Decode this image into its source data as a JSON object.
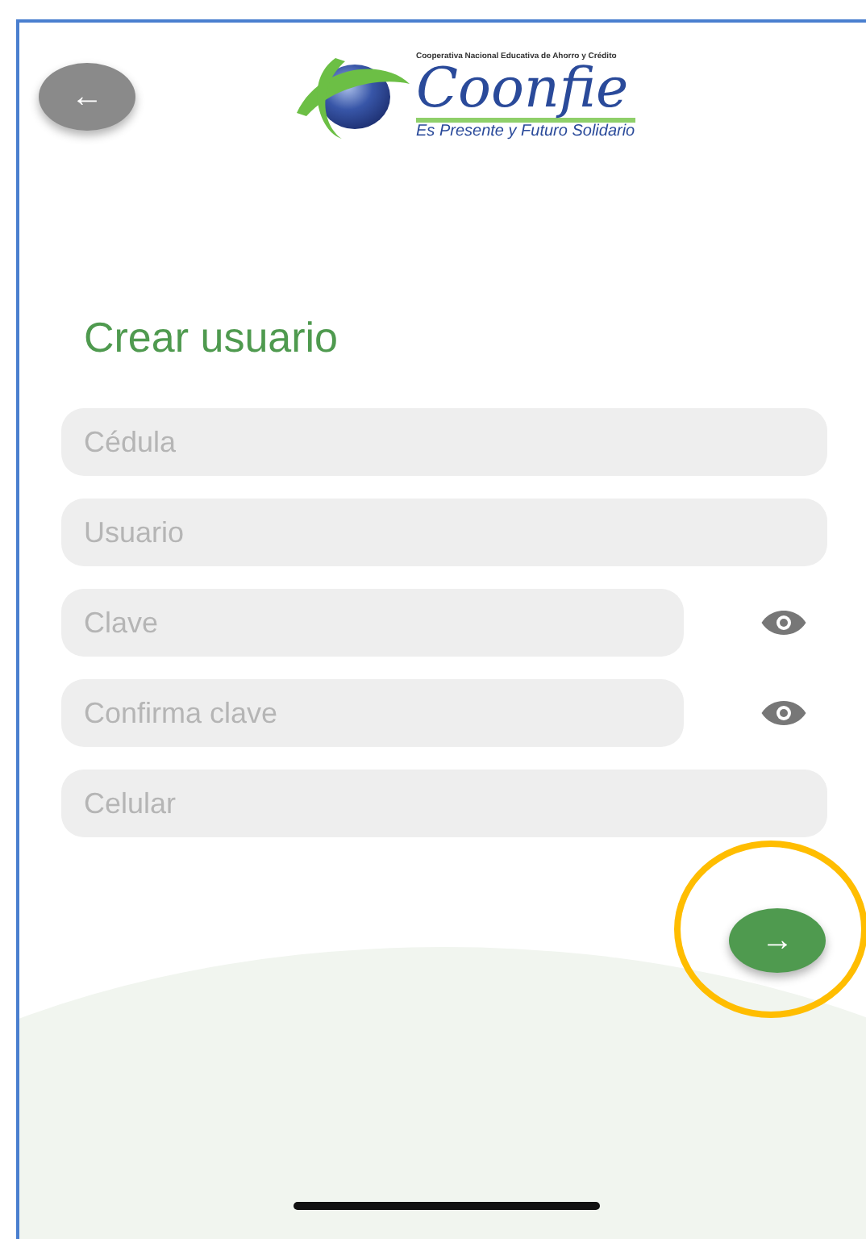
{
  "header": {
    "back_icon": "←",
    "logo": {
      "tagline_top": "Cooperativa Nacional Educativa de Ahorro y Crédito",
      "name": "Coonfie",
      "slogan": "Es Presente y Futuro Solidario"
    }
  },
  "title": "Crear usuario",
  "fields": [
    {
      "placeholder": "Cédula",
      "kind": "text"
    },
    {
      "placeholder": "Usuario",
      "kind": "text"
    },
    {
      "placeholder": "Clave",
      "kind": "password"
    },
    {
      "placeholder": "Confirma clave",
      "kind": "password"
    },
    {
      "placeholder": "Celular",
      "kind": "text"
    }
  ],
  "next_button": {
    "icon": "→",
    "highlighted": true
  }
}
